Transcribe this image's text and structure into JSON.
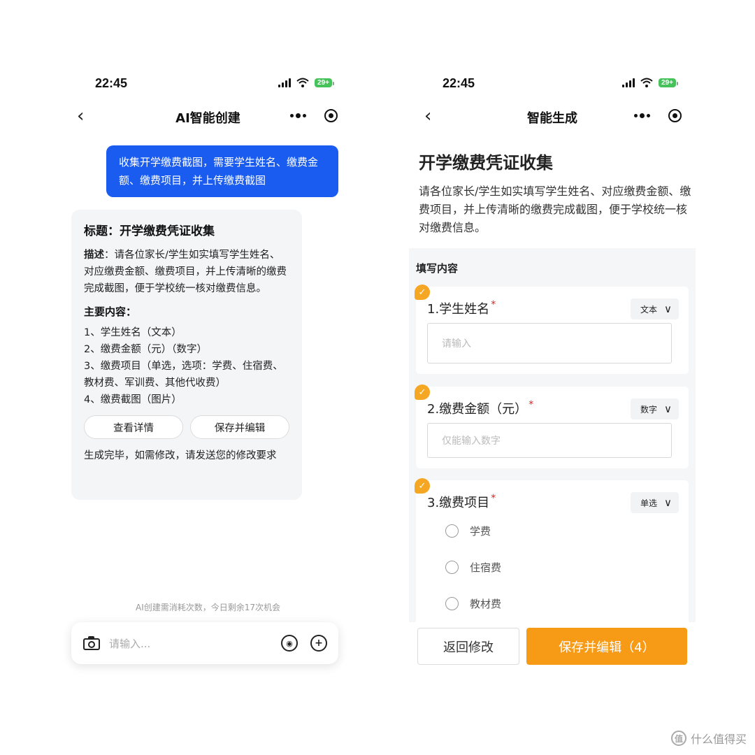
{
  "left": {
    "status": {
      "time": "22:45",
      "battery": "29+"
    },
    "nav": {
      "back": "‹",
      "title": "AI智能创建"
    },
    "user_message": "收集开学缴费截图，需要学生姓名、缴费金额、缴费项目，并上传缴费截图",
    "ai_reply": {
      "title": "标题：开学缴费凭证收集",
      "desc_label": "描述",
      "desc_text": "：请各位家长/学生如实填写学生姓名、对应缴费金额、缴费项目，并上传清晰的缴费完成截图，便于学校统一核对缴费信息。",
      "main_label": "主要内容：",
      "items": [
        "1、学生姓名（文本）",
        "2、缴费金额（元）（数字）",
        "3、缴费项目（单选，选项：学费、住宿费、教材费、军训费、其他代收费）",
        "4、缴费截图（图片）"
      ],
      "view_details": "查看详情",
      "save_edit": "保存并编辑",
      "footer": "生成完毕，如需修改，请发送您的修改要求"
    },
    "quota_note": "AI创建需消耗次数，今日剩余17次机会",
    "input": {
      "placeholder": "请输入..."
    }
  },
  "right": {
    "status": {
      "time": "22:45",
      "battery": "29+"
    },
    "nav": {
      "back": "‹",
      "title": "智能生成"
    },
    "form_title": "开学缴费凭证收集",
    "form_desc": "请各位家长/学生如实填写学生姓名、对应缴费金额、缴费项目，并上传清晰的缴费完成截图，便于学校统一核对缴费信息。",
    "panel_label": "填写内容",
    "questions": [
      {
        "label": "1.学生姓名",
        "required": "*",
        "type": "文本",
        "placeholder": "请输入"
      },
      {
        "label": "2.缴费金额（元）",
        "required": "*",
        "type": "数字",
        "placeholder": "仅能输入数字"
      },
      {
        "label": "3.缴费项目",
        "required": "*",
        "type": "单选",
        "options": [
          "学费",
          "住宿费",
          "教材费"
        ]
      }
    ],
    "back_button": "返回修改",
    "save_button": "保存并编辑（4）"
  },
  "watermark": "什么值得买",
  "watermark_logo": "值",
  "colors": {
    "bubble_blue": "#1a5cf0",
    "accent_orange": "#f79a16",
    "badge_orange": "#f5a623",
    "required_red": "#e02020"
  }
}
